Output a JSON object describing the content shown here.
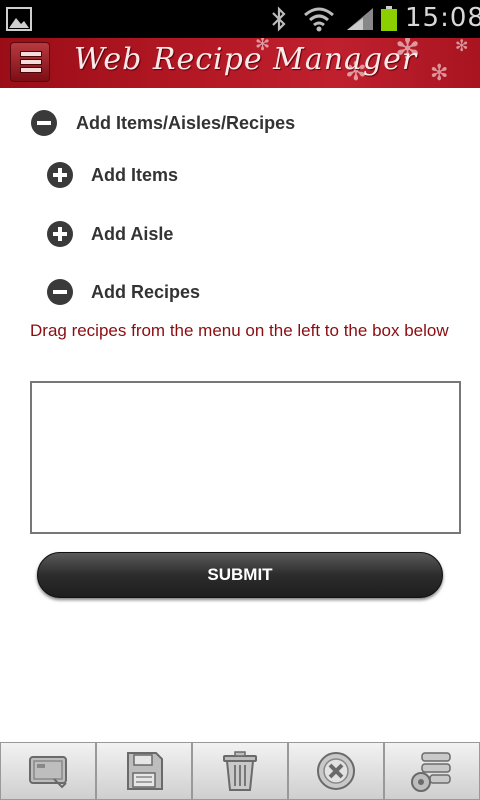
{
  "status_bar": {
    "time": "15:08",
    "icons": [
      "gallery-icon",
      "bluetooth-icon",
      "wifi-icon",
      "signal-icon",
      "battery-icon"
    ],
    "battery_color": "#8ccf00"
  },
  "header": {
    "title": "Web Recipe Manager",
    "menu_icon": "hamburger-menu-icon",
    "background_color": "#b01823"
  },
  "main": {
    "section": {
      "label": "Add Items/Aisles/Recipes",
      "state": "expanded",
      "icon": "minus-circle-icon"
    },
    "subsections": [
      {
        "label": "Add Items",
        "state": "collapsed",
        "icon": "plus-circle-icon"
      },
      {
        "label": "Add Aisle",
        "state": "collapsed",
        "icon": "plus-circle-icon"
      },
      {
        "label": "Add Recipes",
        "state": "expanded",
        "icon": "minus-circle-icon"
      }
    ],
    "hint": "Drag recipes from the menu on the left to the box below",
    "hint_color": "#8b0d12",
    "drop_box_value": "",
    "submit_label": "SUBMIT"
  },
  "toolbar": {
    "buttons": [
      "ticket-icon",
      "save-icon",
      "trash-icon",
      "cancel-icon",
      "settings-list-icon"
    ]
  }
}
